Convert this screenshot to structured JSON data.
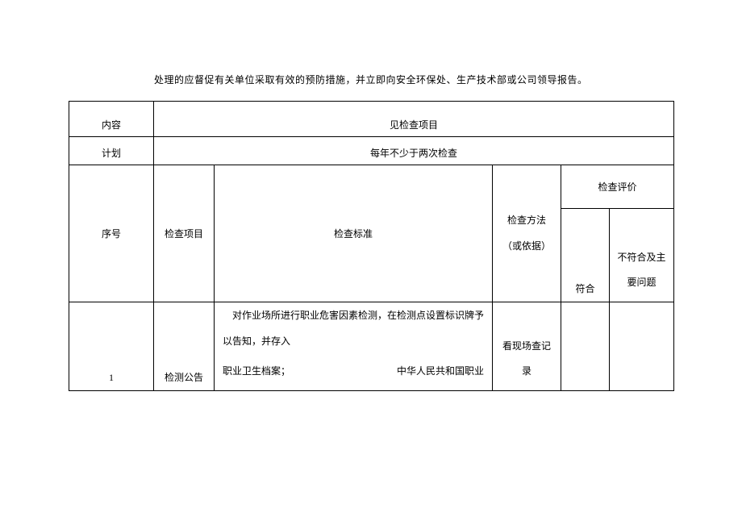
{
  "intro_text": "处理的应督促有关单位采取有效的预防措施，并立即向安全环保处、生产技术部或公司领导报告。",
  "labels": {
    "content": "内容",
    "plan": "计划"
  },
  "values": {
    "content_value": "见检查项目",
    "plan_value": "每年不少于两次检查"
  },
  "headers": {
    "seq": "序号",
    "item": "检查项目",
    "standard": "检查标准",
    "method_line1": "检查方法",
    "method_line2": "（或依据）",
    "eval": "检查评价",
    "eval_ok": "符合",
    "eval_ng_line1": "不符合及主",
    "eval_ng_line2": "要问题"
  },
  "row1": {
    "seq": "1",
    "item": "检测公告",
    "standard_line1": "对作业场所进行职业危害因素检测，在检测点设置标识牌予以告知，并存入",
    "standard_line2_left": "职业卫生档案；",
    "standard_line2_right": "中华人民共和国职业",
    "method_line1": "看现场查记",
    "method_line2": "录",
    "eval_ok": "",
    "eval_ng": ""
  }
}
